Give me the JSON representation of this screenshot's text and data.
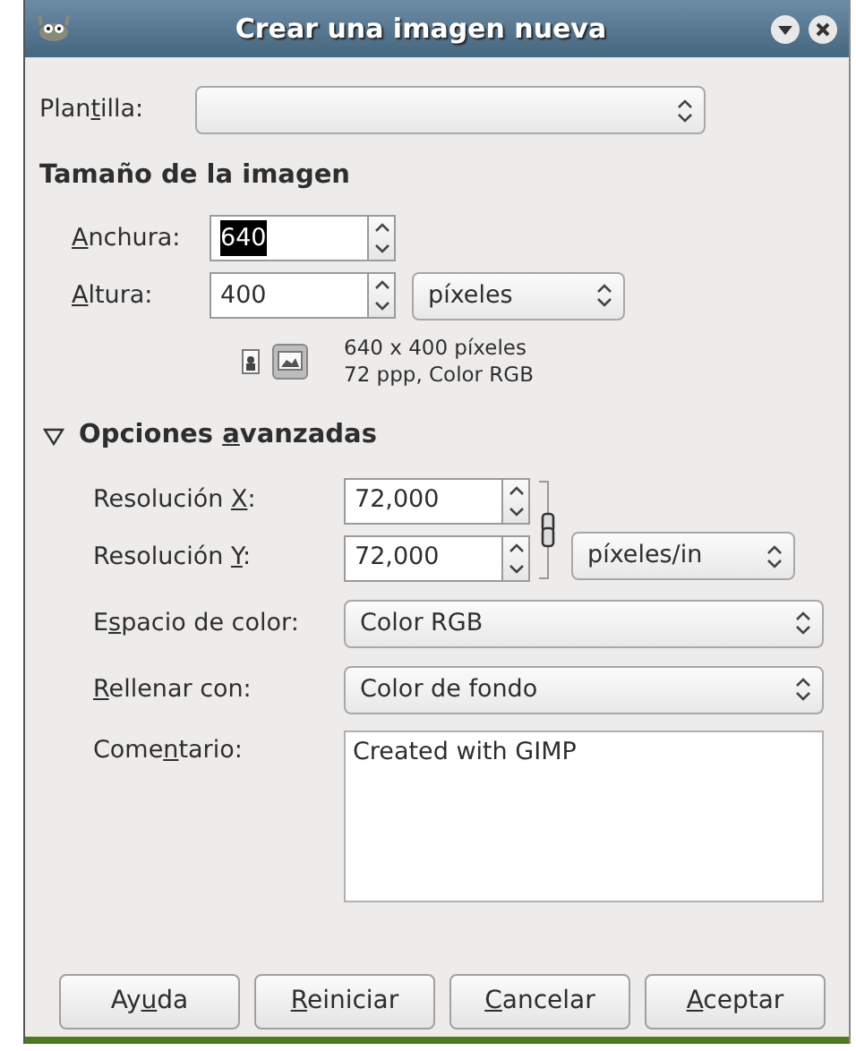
{
  "window": {
    "title": "Crear una imagen nueva"
  },
  "template": {
    "label": {
      "pre": "Plan",
      "key": "t",
      "post": "illa:"
    }
  },
  "image_size": {
    "heading": "Tamaño de la imagen",
    "width": {
      "label": {
        "key": "A",
        "post": "nchura:"
      },
      "value": "640",
      "text_selected": true
    },
    "height": {
      "label": {
        "key": "A",
        "post": "ltura:"
      },
      "value": "400",
      "text_selected": false
    },
    "unit": "píxeles",
    "orientation": [
      {
        "kind": "portrait",
        "selected": false
      },
      {
        "kind": "landscape",
        "selected": true
      }
    ],
    "info": [
      "640 x 400 píxeles",
      "72 ppp, Color RGB"
    ]
  },
  "advanced": {
    "heading": {
      "pre": "Opciones ",
      "key": "a",
      "post": "vanzadas"
    },
    "expanded": true,
    "x_resolution": {
      "label": {
        "pre": "Resolución ",
        "key": "X",
        "post": ":"
      },
      "value": "72,000"
    },
    "y_resolution": {
      "label": {
        "pre": "Resolución ",
        "key": "Y",
        "post": ":"
      },
      "value": "72,000"
    },
    "chained": true,
    "resolution_unit": "píxeles/in",
    "color_space": {
      "label": {
        "pre": "E",
        "key": "s",
        "post": "pacio de color:"
      },
      "value": "Color RGB"
    },
    "fill": {
      "label": {
        "key": "R",
        "post": "ellenar con:"
      },
      "value": "Color de fondo"
    },
    "comment": {
      "label": {
        "pre": "Come",
        "key": "n",
        "post": "tario:"
      },
      "value": "Created with GIMP"
    }
  },
  "buttons": [
    {
      "label": {
        "pre": "Ay",
        "key": "u",
        "post": "da"
      }
    },
    {
      "label": {
        "key": "R",
        "post": "einiciar"
      }
    },
    {
      "label": {
        "key": "C",
        "post": "ancelar"
      }
    },
    {
      "label": {
        "key": "A",
        "post": "ceptar"
      }
    }
  ]
}
